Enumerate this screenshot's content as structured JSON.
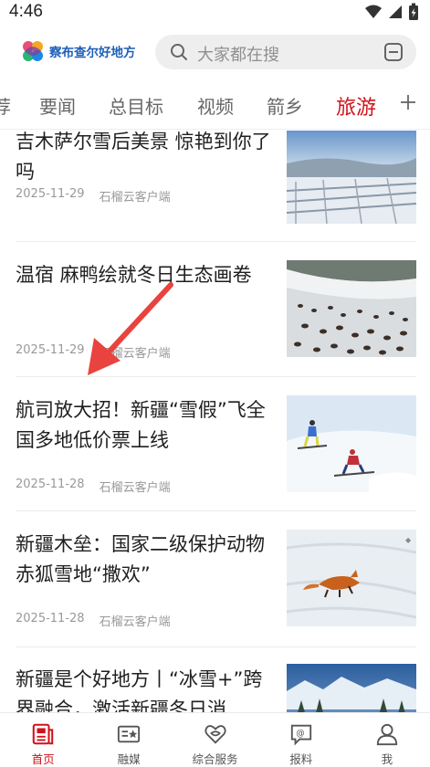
{
  "status_bar": {
    "time": "4:46"
  },
  "header": {
    "logo_text": "察布查尔好地方",
    "search_placeholder": "大家都在搜"
  },
  "tabs": [
    {
      "label": "荐"
    },
    {
      "label": "要闻"
    },
    {
      "label": "总目标"
    },
    {
      "label": "视频"
    },
    {
      "label": "箭乡"
    },
    {
      "label": "旅游",
      "active": true
    }
  ],
  "news": [
    {
      "title": "吉木萨尔雪后美景 惊艳到你了吗",
      "date": "2025-11-29",
      "source": "石榴云客户端",
      "thumb": "snowy-field-aerial"
    },
    {
      "title": "温宿 麻鸭绘就冬日生态画卷",
      "date": "2025-11-29",
      "source": "石榴云客户端",
      "thumb": "ducks-on-snow"
    },
    {
      "title": "航司放大招！新疆“雪假”飞全国多地低价票上线",
      "date": "2025-11-28",
      "source": "石榴云客户端",
      "thumb": "skiers-on-slope"
    },
    {
      "title": "新疆木垒：国家二级保护动物赤狐雪地“撒欢”",
      "date": "2025-11-28",
      "source": "石榴云客户端",
      "thumb": "red-fox-in-snow"
    },
    {
      "title": "新疆是个好地方丨“冰雪+”跨界融合，激活新疆冬日消",
      "date": "",
      "source": "",
      "thumb": "snowy-forest-lake"
    }
  ],
  "bottom_nav": [
    {
      "label": "首页",
      "icon": "news-icon",
      "active": true
    },
    {
      "label": "融媒",
      "icon": "media-card-icon"
    },
    {
      "label": "综合服务",
      "icon": "heart-service-icon"
    },
    {
      "label": "报料",
      "icon": "report-chat-icon"
    },
    {
      "label": "我",
      "icon": "user-icon"
    }
  ],
  "colors": {
    "accent": "#d0121b",
    "logo_blue": "#1e5fb8"
  }
}
